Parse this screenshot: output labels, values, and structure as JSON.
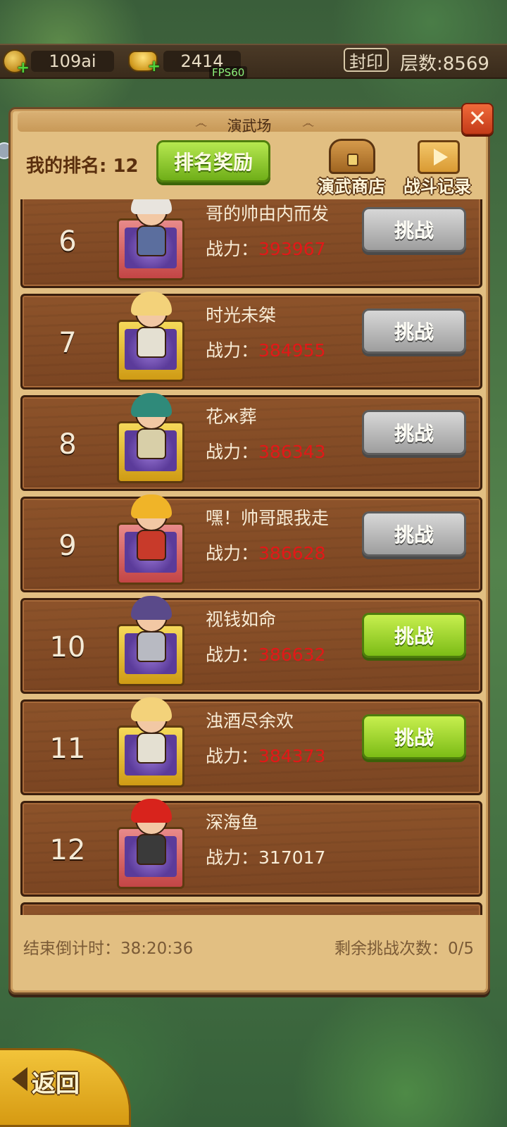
{
  "resources": {
    "coins": "109ai",
    "ingots": "2414",
    "fps": "FPS60",
    "seal_label": "封印",
    "floors": "层数:8569"
  },
  "panel": {
    "title": "演武场",
    "close_label": "✕",
    "my_rank": "我的排名: 12",
    "reward_button": "排名奖励",
    "shop_button": "演武商店",
    "record_button": "战斗记录",
    "power_prefix": "战力：",
    "challenge_label": "挑战"
  },
  "rows": [
    {
      "rank": "6",
      "name": "哥的帅由内而发",
      "power": "393967",
      "plate": "red",
      "button": "gray",
      "hair": "#e8e4de",
      "body": "#5b6e9e"
    },
    {
      "rank": "7",
      "name": "时光未桀",
      "power": "384955",
      "plate": "gold",
      "button": "gray",
      "hair": "#f3d27a",
      "body": "#e4e0d2"
    },
    {
      "rank": "8",
      "name": "花ж葬",
      "power": "386343",
      "plate": "gold",
      "button": "gray",
      "hair": "#2f8a7a",
      "body": "#d8cfa8"
    },
    {
      "rank": "9",
      "name": "嘿！帅哥跟我走",
      "power": "386628",
      "plate": "red",
      "button": "gray",
      "hair": "#f0b428",
      "body": "#c83a2a"
    },
    {
      "rank": "10",
      "name": "视钱如命",
      "power": "386632",
      "plate": "gold",
      "button": "green",
      "hair": "#5a4a8a",
      "body": "#b8bac2"
    },
    {
      "rank": "11",
      "name": "浊酒尽余欢",
      "power": "384373",
      "plate": "gold",
      "button": "green",
      "hair": "#f3d27a",
      "body": "#e4e0d2"
    },
    {
      "rank": "12",
      "name": "深海鱼",
      "power": "317017",
      "plate": "red",
      "button": "none",
      "hair": "#d8231c",
      "body": "#3a3a3a"
    }
  ],
  "footer": {
    "countdown": "结束倒计时：38:20:36",
    "remaining": "剩余挑战次数：0/5"
  },
  "back_label": "返回"
}
